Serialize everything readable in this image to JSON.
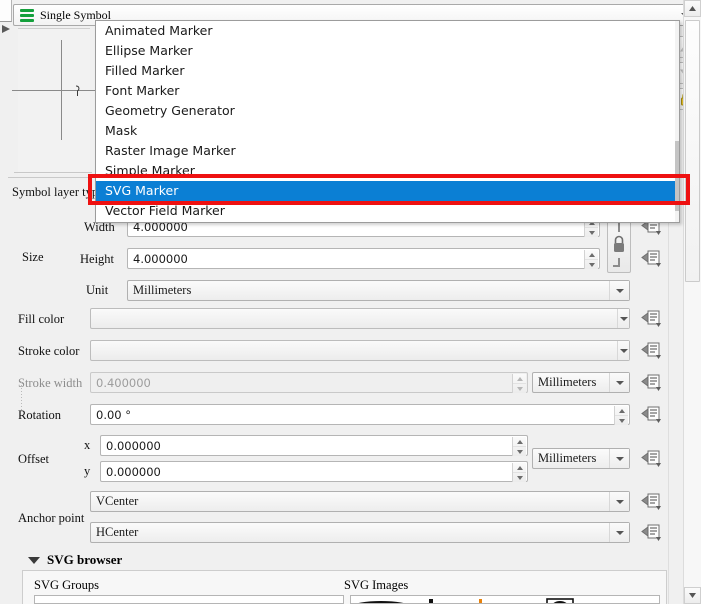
{
  "window": {
    "symbol_combo_label": "Single Symbol",
    "symbol_combo_icon": "single-symbol-green-bars-icon"
  },
  "dropdown": {
    "open": true,
    "items": [
      "Animated Marker",
      "Ellipse Marker",
      "Filled Marker",
      "Font Marker",
      "Geometry Generator",
      "Mask",
      "Raster Image Marker",
      "Simple Marker",
      "SVG Marker",
      "Vector Field Marker"
    ],
    "selected": "SVG Marker",
    "selected_index": 8,
    "highlight_color": "#0b7fd4",
    "annotation_box_color": "#ee1111"
  },
  "form": {
    "symbol_layer_type_label": "Symbol layer type",
    "size_label": "Size",
    "width_label": "Width",
    "width_value": "4.000000",
    "height_label": "Height",
    "height_value": "4.000000",
    "unit_label": "Unit",
    "unit_value": "Millimeters",
    "fill_color_label": "Fill color",
    "fill_color_value": "",
    "stroke_color_label": "Stroke color",
    "stroke_color_value": "",
    "stroke_width_label": "Stroke width",
    "stroke_width_value": "0.400000",
    "stroke_width_unit": "Millimeters",
    "rotation_label": "Rotation",
    "rotation_value": "0.00 °",
    "offset_label": "Offset",
    "offset_x_label": "x",
    "offset_x_value": "0.000000",
    "offset_y_label": "y",
    "offset_y_value": "0.000000",
    "offset_unit": "Millimeters",
    "anchor_point_label": "Anchor point",
    "anchor_vertical_value": "VCenter",
    "anchor_horizontal_value": "HCenter"
  },
  "svg_browser": {
    "section_title": "SVG browser",
    "expanded": true,
    "groups_label": "SVG Groups",
    "images_label": "SVG Images"
  },
  "toolbar": {
    "move_up_icon": "arrow-up-icon",
    "move_down_icon": "arrow-down-icon",
    "lock_icon": "lock-open-yellow-icon",
    "link_icon": "chain-lock-icon",
    "data_defined_icon": "data-defined-override-icon"
  },
  "colors": {
    "background": "#f0f0f0",
    "selection_blue": "#0b7fd4",
    "annotation_red": "#ee1111",
    "symbol_green": "#14a03c",
    "lock_yellow": "#e8c22a"
  }
}
